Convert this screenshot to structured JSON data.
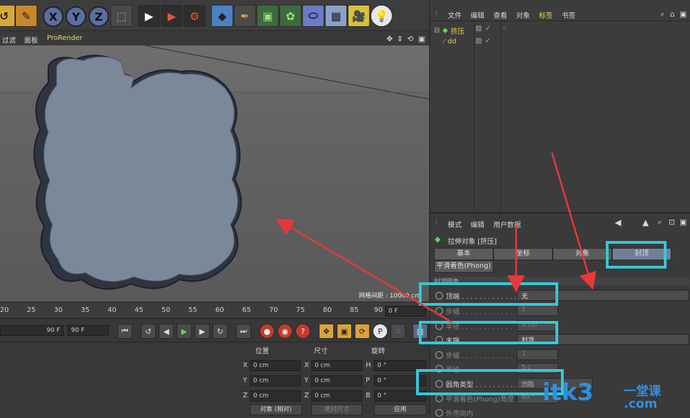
{
  "toolbar": {
    "axis_x": "X",
    "axis_y": "Y",
    "axis_z": "Z",
    "icons": [
      "undo-icon",
      "live-select-icon",
      "lock-x-icon",
      "lock-y-icon",
      "lock-z-icon",
      "coord-system-icon",
      "render-view-icon",
      "render-picture-icon",
      "render-settings-icon",
      "cube-icon",
      "pen-spline-icon",
      "subdivision-icon",
      "cloner-icon",
      "deformer-icon",
      "floor-icon",
      "camera-icon",
      "light-icon"
    ]
  },
  "viewport_menu": {
    "filter": "过滤",
    "panel": "面板",
    "prorender": "ProRender"
  },
  "viewport": {
    "grid_spacing": "网格间距 : 10000 cm"
  },
  "timeline": {
    "ticks": [
      "20",
      "25",
      "30",
      "35",
      "40",
      "45",
      "50",
      "55",
      "60",
      "65",
      "70",
      "75",
      "80",
      "85",
      "90"
    ],
    "current_frame": "0 F",
    "end_frame_a": "90 F",
    "end_frame_b": "90 F"
  },
  "coords": {
    "position": "位置",
    "size": "尺寸",
    "rotation": "旋转",
    "rows": [
      {
        "axis": "X",
        "pos": "0 cm",
        "size_axis": "X",
        "size": "0 cm",
        "rot_axis": "H",
        "rot": "0 °"
      },
      {
        "axis": "Y",
        "pos": "0 cm",
        "size_axis": "Y",
        "size": "0 cm",
        "rot_axis": "P",
        "rot": "0 °"
      },
      {
        "axis": "Z",
        "pos": "0 cm",
        "size_axis": "Z",
        "size": "0 cm",
        "rot_axis": "B",
        "rot": "0 °"
      }
    ],
    "mode": "对象 (相对)",
    "size_mode": "绝对尺寸",
    "apply": "应用"
  },
  "object_manager": {
    "menu": [
      "文件",
      "编辑",
      "查看",
      "对象",
      "标签",
      "书签"
    ],
    "active_menu": "标签",
    "objects": [
      {
        "name": "挤压"
      },
      {
        "name": "dd"
      }
    ]
  },
  "attributes": {
    "menu": [
      "模式",
      "编辑",
      "用户数据"
    ],
    "title": "拉伸对象 [挤压]",
    "tabs": [
      "基本",
      "坐标",
      "对象",
      "封顶"
    ],
    "active_tab": "封顶",
    "subtab": "平滑着色(Phong)",
    "section": "封顶圆角",
    "props": [
      {
        "label": "顶端",
        "value": "无"
      },
      {
        "label": "步幅",
        "value": "1"
      },
      {
        "label": "半径",
        "value": "5 cm"
      },
      {
        "label": "末端",
        "value": "封顶"
      },
      {
        "label": "步幅",
        "value": "1"
      },
      {
        "label": "半径",
        "value": "5 c"
      },
      {
        "label": "圆角类型",
        "value": "凹陷"
      },
      {
        "label": "平滑着色(Phong)角度",
        "value": "60 °"
      },
      {
        "label": "外壳向内",
        "value": ""
      }
    ]
  },
  "colors": {
    "highlight": "#35c9d8",
    "arrow": "#e8383a",
    "watermark_blue": "#2f8fe0"
  },
  "watermark": {
    "brand": "itk3",
    "sub": "一堂课",
    "domain": ".com"
  }
}
